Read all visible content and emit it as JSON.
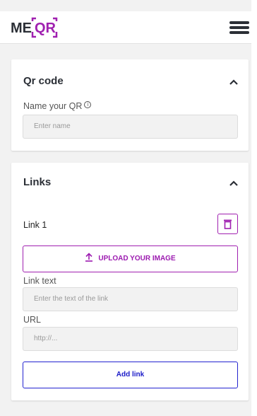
{
  "brand": {
    "logo_text_me": "ME",
    "logo_text_qr": "QR",
    "accent": "#a020b0",
    "dark": "#2b2f36"
  },
  "header": {
    "menu_icon": "hamburger-menu-icon"
  },
  "qr_card": {
    "title": "Qr code",
    "name_label": "Name your QR",
    "info_icon": "info-icon",
    "info_glyph": "i",
    "name_placeholder": "Enter name"
  },
  "links_card": {
    "title": "Links",
    "link_label": "Link 1",
    "trash_icon": "trash-icon",
    "upload_label": "UPLOAD YOUR IMAGE",
    "upload_icon": "upload-icon",
    "link_text_label": "Link text",
    "link_text_placeholder": "Enter the text of the link",
    "url_label": "URL",
    "url_placeholder": "http://...",
    "add_link_label": "Add link",
    "add_link_color": "#1a1ac8"
  }
}
